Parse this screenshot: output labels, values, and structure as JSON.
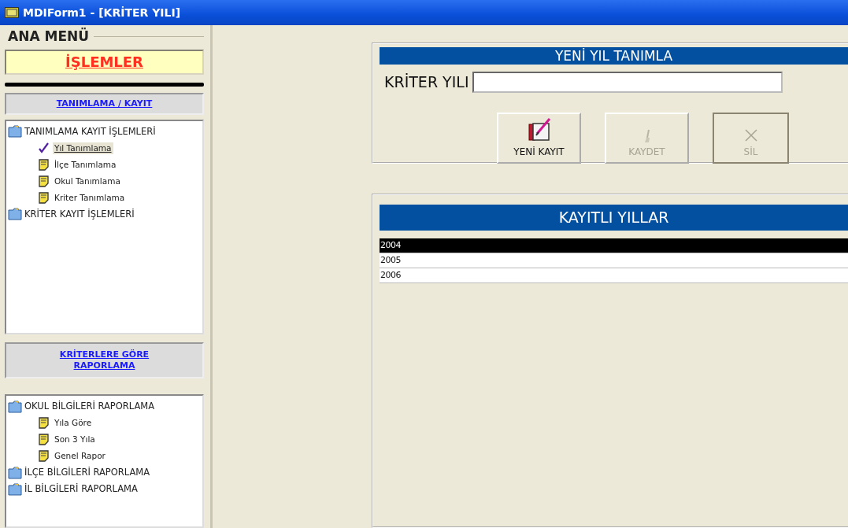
{
  "window": {
    "title": "MDIForm1 - [KRİTER YILI]"
  },
  "sidebar": {
    "group_title": "ANA MENÜ",
    "section_title": "İŞLEMLER",
    "panels": [
      {
        "title": "TANIMLAMA /  KAYIT",
        "tree": [
          {
            "label": "TANIMLAMA KAYIT İŞLEMLERİ",
            "children": [
              {
                "label": "Yıl Tanımlama",
                "selected": true
              },
              {
                "label": "İlçe Tanımlama",
                "selected": false
              },
              {
                "label": "Okul Tanımlama",
                "selected": false
              },
              {
                "label": "Kriter Tanımlama",
                "selected": false
              }
            ]
          },
          {
            "label": "KRİTER KAYIT İŞLEMLERİ"
          }
        ]
      },
      {
        "title": "KRİTERLERE GÖRE RAPORLAMA",
        "tree": [
          {
            "label": "OKUL BİLGİLERİ RAPORLAMA",
            "children": [
              {
                "label": "Yıla Göre",
                "selected": false
              },
              {
                "label": "Son 3 Yıla",
                "selected": false
              },
              {
                "label": "Genel Rapor",
                "selected": false
              }
            ]
          },
          {
            "label": "İLÇE BİLGİLERİ RAPORLAMA"
          },
          {
            "label": "İL  BİLGİLERİ RAPORLAMA"
          }
        ]
      }
    ]
  },
  "form": {
    "title": "YENİ YIL TANIMLA",
    "field_label": "KRİTER YILI",
    "buttons": [
      {
        "kind": "new",
        "label": "YENİ KAYIT",
        "disabled": false
      },
      {
        "kind": "save",
        "label": "KAYDET",
        "disabled": true
      },
      {
        "kind": "delete",
        "label": "SİL",
        "disabled": true
      }
    ]
  },
  "list": {
    "title": "KAYITLI YILLAR",
    "rows": [
      {
        "text": "2004",
        "selected": true
      },
      {
        "text": "2005",
        "selected": false
      },
      {
        "text": "2006",
        "selected": false
      }
    ]
  }
}
